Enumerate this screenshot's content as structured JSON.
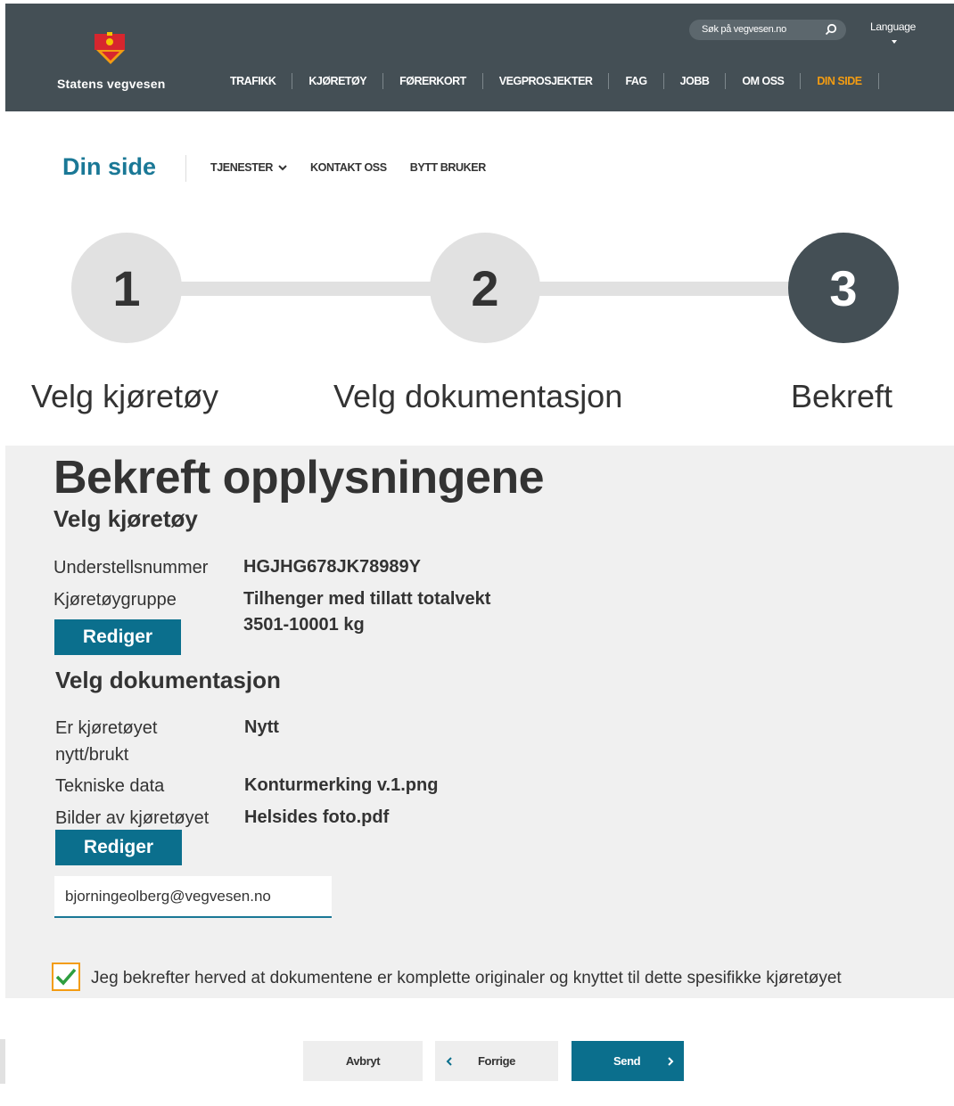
{
  "header": {
    "logo_text": "Statens vegvesen",
    "search_placeholder": "Søk på vegvesen.no",
    "language_label": "Language",
    "nav": [
      {
        "label": "TRAFIKK"
      },
      {
        "label": "KJØRETØY"
      },
      {
        "label": "FØRERKORT"
      },
      {
        "label": "VEGPROSJEKTER"
      },
      {
        "label": "FAG"
      },
      {
        "label": "JOBB"
      },
      {
        "label": "OM OSS"
      },
      {
        "label": "DIN SIDE",
        "active": true
      }
    ]
  },
  "subnav": {
    "title": "Din side",
    "items": [
      "TJENESTER",
      "KONTAKT OSS",
      "BYTT BRUKER"
    ]
  },
  "stepper": {
    "steps": [
      {
        "number": "1",
        "label": "Velg kjøretøy"
      },
      {
        "number": "2",
        "label": "Velg dokumentasjon"
      },
      {
        "number": "3",
        "label": "Bekreft",
        "active": true
      }
    ]
  },
  "summary": {
    "title": "Bekreft opplysningene",
    "vehicle_section": {
      "title": "Velg kjøretøy",
      "fields": [
        {
          "label": "Understellsnummer",
          "value": "HGJHG678JK78989Y"
        },
        {
          "label": "Kjøretøygruppe",
          "value": "Tilhenger med tillatt totalvekt",
          "value_line2": "3501-10001 kg"
        }
      ],
      "edit_label": "Rediger"
    },
    "docs_section": {
      "title": "Velg dokumentasjon",
      "fields": [
        {
          "label": "Er kjøretøyet",
          "label_line2": "nytt/brukt",
          "value": "Nytt"
        },
        {
          "label": "Tekniske data",
          "value": "Konturmerking v.1.png"
        },
        {
          "label": "Bilder av kjøretøyet",
          "value": "Helsides foto.pdf"
        }
      ],
      "edit_label": "Rediger"
    },
    "email_value": "bjorningeolberg@vegvesen.no",
    "confirm_checked": true,
    "confirm_text": "Jeg bekrefter herved at dokumentene er komplette originaler og knyttet til dette spesifikke kjøretøyet"
  },
  "actions": {
    "cancel_label": "Avbryt",
    "previous_label": "Forrige",
    "send_label": "Send"
  },
  "colors": {
    "header_bg": "#444f55",
    "accent_blue": "#0b6f8d",
    "active_orange": "#f39c12",
    "panel_bg": "#f0f0f0"
  }
}
